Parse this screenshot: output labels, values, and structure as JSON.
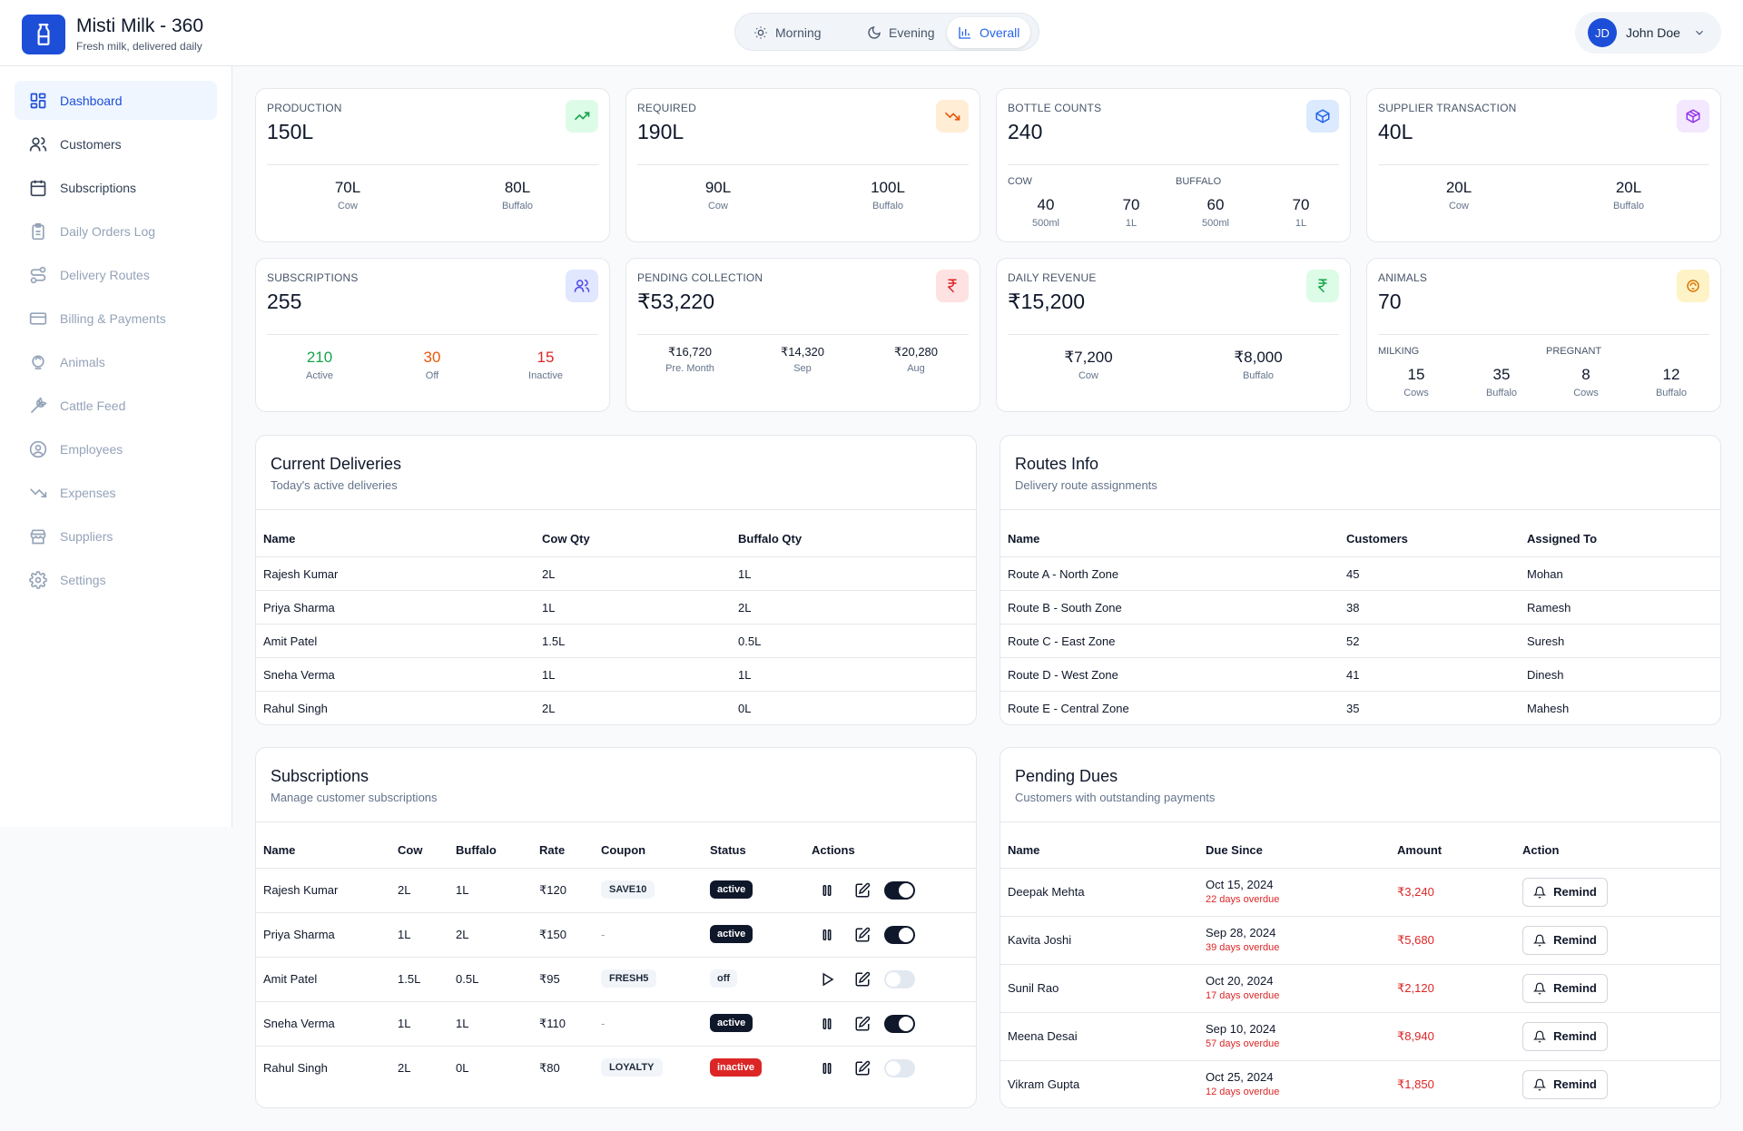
{
  "brand": {
    "title": "Misti Milk - 360",
    "subtitle": "Fresh milk, delivered daily"
  },
  "shifts": [
    {
      "label": "Morning"
    },
    {
      "label": "Evening"
    },
    {
      "label": "Overall"
    }
  ],
  "user": {
    "initials": "JD",
    "name": "John Doe"
  },
  "sidebar": {
    "items": [
      {
        "label": "Dashboard"
      },
      {
        "label": "Customers"
      },
      {
        "label": "Subscriptions"
      },
      {
        "label": "Daily Orders Log"
      },
      {
        "label": "Delivery Routes"
      },
      {
        "label": "Billing & Payments"
      },
      {
        "label": "Animals"
      },
      {
        "label": "Cattle Feed"
      },
      {
        "label": "Employees"
      },
      {
        "label": "Expenses"
      },
      {
        "label": "Suppliers"
      },
      {
        "label": "Settings"
      }
    ]
  },
  "stats": {
    "production": {
      "label": "PRODUCTION",
      "value": "150L",
      "cow": "70L",
      "cow_label": "Cow",
      "buffalo": "80L",
      "buffalo_label": "Buffalo"
    },
    "required": {
      "label": "REQUIRED",
      "value": "190L",
      "cow": "90L",
      "cow_label": "Cow",
      "buffalo": "100L",
      "buffalo_label": "Buffalo"
    },
    "bottles": {
      "label": "BOTTLE COUNTS",
      "value": "240",
      "cow_label": "COW",
      "buffalo_label": "BUFFALO",
      "items": [
        {
          "v": "40",
          "l": "500ml"
        },
        {
          "v": "70",
          "l": "1L"
        },
        {
          "v": "60",
          "l": "500ml"
        },
        {
          "v": "70",
          "l": "1L"
        }
      ]
    },
    "supplier": {
      "label": "SUPPLIER TRANSACTION",
      "value": "40L",
      "cow": "20L",
      "cow_label": "Cow",
      "buffalo": "20L",
      "buffalo_label": "Buffalo"
    },
    "subscriptions": {
      "label": "SUBSCRIPTIONS",
      "value": "255",
      "active": "210",
      "active_label": "Active",
      "off": "30",
      "off_label": "Off",
      "inactive": "15",
      "inactive_label": "Inactive"
    },
    "pending": {
      "label": "PENDING COLLECTION",
      "value": "₹53,220",
      "items": [
        {
          "v": "₹16,720",
          "l": "Pre. Month"
        },
        {
          "v": "₹14,320",
          "l": "Sep"
        },
        {
          "v": "₹20,280",
          "l": "Aug"
        }
      ]
    },
    "revenue": {
      "label": "DAILY REVENUE",
      "value": "₹15,200",
      "cow": "₹7,200",
      "cow_label": "Cow",
      "buffalo": "₹8,000",
      "buffalo_label": "Buffalo"
    },
    "animals": {
      "label": "ANIMALS",
      "value": "70",
      "milking_label": "MILKING",
      "pregnant_label": "PREGNANT",
      "items": [
        {
          "v": "15",
          "l": "Cows"
        },
        {
          "v": "35",
          "l": "Buffalo"
        },
        {
          "v": "8",
          "l": "Cows"
        },
        {
          "v": "12",
          "l": "Buffalo"
        }
      ]
    }
  },
  "deliveries": {
    "title": "Current Deliveries",
    "subtitle": "Today's active deliveries",
    "headers": [
      "Name",
      "Cow Qty",
      "Buffalo Qty"
    ],
    "rows": [
      [
        "Rajesh Kumar",
        "2L",
        "1L"
      ],
      [
        "Priya Sharma",
        "1L",
        "2L"
      ],
      [
        "Amit Patel",
        "1.5L",
        "0.5L"
      ],
      [
        "Sneha Verma",
        "1L",
        "1L"
      ],
      [
        "Rahul Singh",
        "2L",
        "0L"
      ]
    ]
  },
  "routes": {
    "title": "Routes Info",
    "subtitle": "Delivery route assignments",
    "headers": [
      "Name",
      "Customers",
      "Assigned To"
    ],
    "rows": [
      [
        "Route A - North Zone",
        "45",
        "Mohan"
      ],
      [
        "Route B - South Zone",
        "38",
        "Ramesh"
      ],
      [
        "Route C - East Zone",
        "52",
        "Suresh"
      ],
      [
        "Route D - West Zone",
        "41",
        "Dinesh"
      ],
      [
        "Route E - Central Zone",
        "35",
        "Mahesh"
      ]
    ]
  },
  "subscriptions_table": {
    "title": "Subscriptions",
    "subtitle": "Manage customer subscriptions",
    "headers": [
      "Name",
      "Cow",
      "Buffalo",
      "Rate",
      "Coupon",
      "Status",
      "Actions"
    ],
    "rows": [
      {
        "name": "Rajesh Kumar",
        "cow": "2L",
        "buffalo": "1L",
        "rate": "₹120",
        "coupon": "SAVE10",
        "status": "active",
        "toggle": true,
        "action": "pause"
      },
      {
        "name": "Priya Sharma",
        "cow": "1L",
        "buffalo": "2L",
        "rate": "₹150",
        "coupon": "-",
        "status": "active",
        "toggle": true,
        "action": "pause"
      },
      {
        "name": "Amit Patel",
        "cow": "1.5L",
        "buffalo": "0.5L",
        "rate": "₹95",
        "coupon": "FRESH5",
        "status": "off",
        "toggle": false,
        "action": "play"
      },
      {
        "name": "Sneha Verma",
        "cow": "1L",
        "buffalo": "1L",
        "rate": "₹110",
        "coupon": "-",
        "status": "active",
        "toggle": true,
        "action": "pause"
      },
      {
        "name": "Rahul Singh",
        "cow": "2L",
        "buffalo": "0L",
        "rate": "₹80",
        "coupon": "LOYALTY",
        "status": "inactive",
        "toggle": false,
        "action": "pause"
      }
    ]
  },
  "dues": {
    "title": "Pending Dues",
    "subtitle": "Customers with outstanding payments",
    "headers": [
      "Name",
      "Due Since",
      "Amount",
      "Action"
    ],
    "remind_label": "Remind",
    "rows": [
      {
        "name": "Deepak Mehta",
        "date": "Oct 15, 2024",
        "overdue": "22 days overdue",
        "amount": "₹3,240"
      },
      {
        "name": "Kavita Joshi",
        "date": "Sep 28, 2024",
        "overdue": "39 days overdue",
        "amount": "₹5,680"
      },
      {
        "name": "Sunil Rao",
        "date": "Oct 20, 2024",
        "overdue": "17 days overdue",
        "amount": "₹2,120"
      },
      {
        "name": "Meena Desai",
        "date": "Sep 10, 2024",
        "overdue": "57 days overdue",
        "amount": "₹8,940"
      },
      {
        "name": "Vikram Gupta",
        "date": "Oct 25, 2024",
        "overdue": "12 days overdue",
        "amount": "₹1,850"
      }
    ]
  },
  "colors": {
    "accent": "#1d4ed8",
    "success": "#16a34a",
    "warning": "#ea580c",
    "danger": "#dc2626"
  }
}
